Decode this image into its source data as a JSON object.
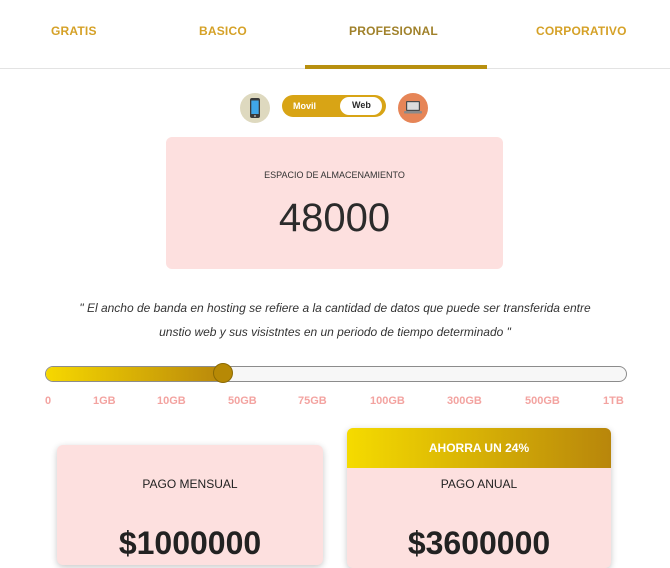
{
  "tabs": [
    {
      "label": "GRATIS"
    },
    {
      "label": "BASICO"
    },
    {
      "label": "PROFESIONAL"
    },
    {
      "label": "CORPORATIVO"
    }
  ],
  "active_tab": "PROFESIONAL",
  "toggle": {
    "left_label": "Movil",
    "right_label": "Web",
    "selected": "Web"
  },
  "icons": {
    "left": "smartphone-icon",
    "right": "laptop-icon"
  },
  "storage": {
    "label": "ESPACIO DE ALMACENAMIENTO",
    "value": "48000"
  },
  "quote": {
    "line1": "\" El ancho de banda en hosting se refiere a la cantidad de datos que puede ser transferida entre",
    "line2": "unstio web y sus visistntes en un periodo de tiempo determinado \""
  },
  "slider": {
    "ticks": [
      "0",
      "1GB",
      "10GB",
      "50GB",
      "75GB",
      "100GB",
      "300GB",
      "500GB",
      "1TB"
    ],
    "fill_fraction": 0.31
  },
  "pricing": {
    "monthly": {
      "title": "PAGO MENSUAL",
      "price": "$1000000"
    },
    "annual": {
      "badge": "AHORRA UN 24%",
      "title": "PAGO ANUAL",
      "price": "$3600000"
    }
  },
  "colors": {
    "accent": "#d5a127",
    "card_bg": "#fde0df",
    "tick_color": "#f3a3a0",
    "toggle_bg": "#d8a415"
  }
}
